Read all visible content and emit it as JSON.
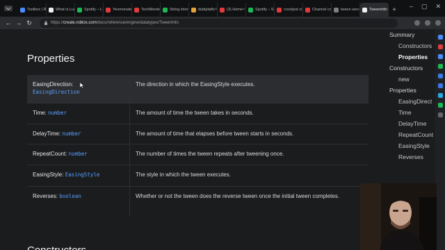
{
  "browser": {
    "tabs": [
      {
        "label": "Toolbox | R",
        "color": "#4a8cff"
      },
      {
        "label": "What is Lua",
        "color": "#f0f0f0"
      },
      {
        "label": "Spotify – L",
        "color": "#1db954"
      },
      {
        "label": "Yeomonste",
        "color": "#e23b3b"
      },
      {
        "label": "TechMontes",
        "color": "#e23b3b"
      },
      {
        "label": "String inter",
        "color": "#1db954"
      },
      {
        "label": "dublplatfo",
        "color": "#e6a33a"
      },
      {
        "label": "(3) Home",
        "color": "#e23b3b"
      },
      {
        "label": "Spotify – Se",
        "color": "#1db954"
      },
      {
        "label": "crockpot ci",
        "color": "#e23b3b"
      },
      {
        "label": "Channel co",
        "color": "#e23b3b"
      },
      {
        "label": "tween serv",
        "color": "#7f7f7f"
      },
      {
        "label": "TweenInfo",
        "color": "#f0f0f0",
        "active": true
      }
    ],
    "url_prefix": "https://",
    "url_host": "create.roblox.com",
    "url_path": "/docs/reference/engine/datatypes/TweenInfo"
  },
  "page": {
    "title": "Properties",
    "next_heading": "Constructors",
    "properties": [
      {
        "name": "EasingDirection:",
        "type": "EasingDirection",
        "desc": "The direction in which the EasingStyle executes."
      },
      {
        "name": "Time:",
        "type": "number",
        "desc": "The amount of time the tween takes in seconds."
      },
      {
        "name": "DelayTime:",
        "type": "number",
        "desc": "The amount of time that elapses before tween starts in seconds."
      },
      {
        "name": "RepeatCount:",
        "type": "number",
        "desc": "The number of times the tween repeats after tweening once."
      },
      {
        "name": "EasingStyle:",
        "type": "EasingStyle",
        "desc": "The style in which the tween executes."
      },
      {
        "name": "Reverses:",
        "type": "boolean",
        "desc": "Whether or not the tween does the reverse tween once the initial tween completes."
      }
    ]
  },
  "toc": {
    "summary": "Summary",
    "summary_constructors": "Constructors",
    "summary_properties": "Properties",
    "constructors": "Constructors",
    "ctor_new": "new",
    "properties": "Properties",
    "p1": "EasingDirect",
    "p2": "Time",
    "p3": "DelayTime",
    "p4": "RepeatCount",
    "p5": "EasingStyle",
    "p6": "Reverses"
  },
  "colors": {
    "link": "#5aa0ff",
    "page_bg": "#1b1c1e",
    "row_highlight": "#2c2d30"
  }
}
